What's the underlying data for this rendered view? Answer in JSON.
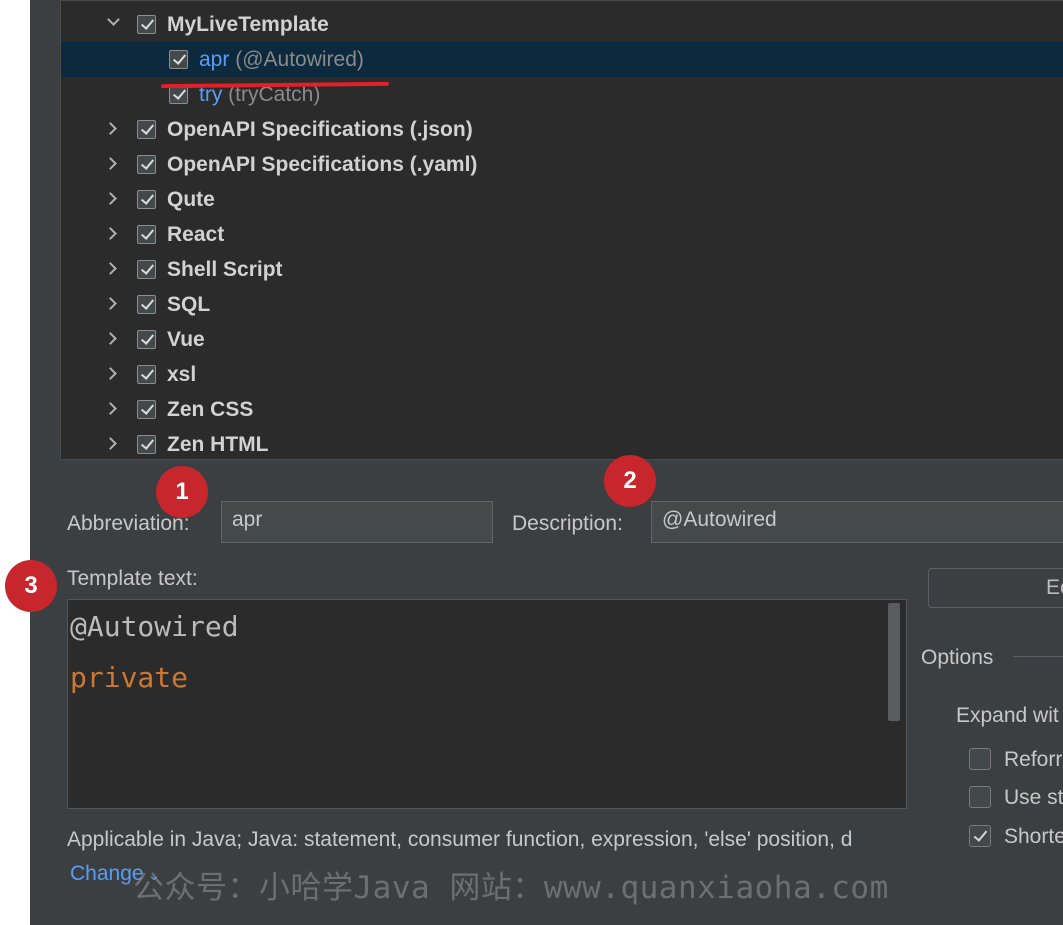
{
  "tree": {
    "group": {
      "label": "MyLiveTemplate",
      "checked": true,
      "expanded": true
    },
    "templates": [
      {
        "abbr": "apr",
        "desc": "(@Autowired)",
        "checked": true,
        "selected": true
      },
      {
        "abbr": "try",
        "desc": "(tryCatch)",
        "checked": true,
        "selected": false
      }
    ],
    "groups": [
      {
        "label": "OpenAPI Specifications (.json)",
        "checked": true
      },
      {
        "label": "OpenAPI Specifications (.yaml)",
        "checked": true
      },
      {
        "label": "Qute",
        "checked": true
      },
      {
        "label": "React",
        "checked": true
      },
      {
        "label": "Shell Script",
        "checked": true
      },
      {
        "label": "SQL",
        "checked": true
      },
      {
        "label": "Vue",
        "checked": true
      },
      {
        "label": "xsl",
        "checked": true
      },
      {
        "label": "Zen CSS",
        "checked": true
      },
      {
        "label": "Zen HTML",
        "checked": true
      }
    ]
  },
  "badges": [
    "1",
    "2",
    "3"
  ],
  "form": {
    "abbreviation_label": "Abbreviation:",
    "abbreviation_value": "apr",
    "description_label": "Description:",
    "description_value": "@Autowired",
    "template_text_label": "Template text:",
    "template_lines": [
      "@Autowired",
      "private"
    ]
  },
  "edit_button_label": "Ec",
  "options": {
    "title": "Options",
    "expand_label": "Expand wit",
    "checkboxes": [
      {
        "label": "Reforr",
        "checked": false
      },
      {
        "label": "Use st",
        "checked": false
      },
      {
        "label": "Shorte",
        "checked": true
      }
    ]
  },
  "applicable_text": "Applicable in Java; Java: statement, consumer function, expression, 'else' position, d",
  "change_link": "Change",
  "watermark": "公众号：小哈学Java 网站：www.quanxiaoha.com",
  "colors": {
    "accent": "#589df6",
    "badge": "#c7262c",
    "keyword": "#cc7832",
    "annotation": "#bbbbbb",
    "underline": "#e0202a"
  }
}
